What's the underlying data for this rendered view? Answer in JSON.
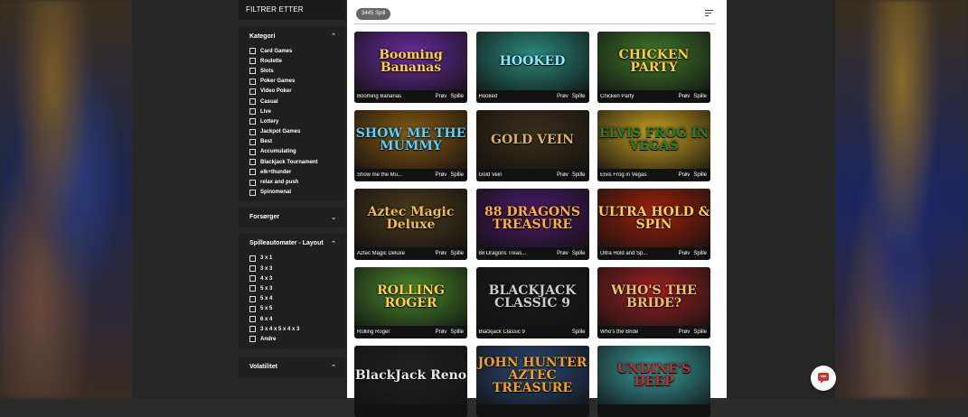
{
  "sidebar": {
    "header": "FILTRER ETTER",
    "kategori": {
      "title": "Kategori",
      "items": [
        "Card Games",
        "Roulette",
        "Slots",
        "Poker Games",
        "Video Poker",
        "Casual",
        "Live",
        "Lottery",
        "Jackpot Games",
        "Best",
        "Accumulating",
        "Blackjack Tournament",
        "elk+thunder",
        "relax and push",
        "Spinomenal"
      ]
    },
    "forsorger": {
      "title": "Forsørger"
    },
    "layout": {
      "title": "Spilleautomater - Layout",
      "items": [
        "3 x 1",
        "3 x 3",
        "4 x 3",
        "5 x 3",
        "5 x 4",
        "5 x 5",
        "6 x 4",
        "3 x 4 x 5 x 4 x 3",
        "Andre"
      ]
    },
    "volatilitet": {
      "title": "Volatilitet"
    }
  },
  "main": {
    "count": "3445 Spill",
    "games": [
      {
        "name": "Booming Bananas",
        "art": "Booming Bananas",
        "demo": "Prøv",
        "play": "Spille",
        "bg": "#6a2ca0",
        "color": "#ffd23a"
      },
      {
        "name": "Hooked",
        "art": "HOOKED",
        "demo": "Prøv",
        "play": "Spille",
        "bg": "#2a8a7a",
        "color": "#8fe8ff"
      },
      {
        "name": "Chicken Party",
        "art": "CHICKEN PARTY",
        "demo": "Prøv",
        "play": "Spille",
        "bg": "#3f7a2a",
        "color": "#ffcf3a"
      },
      {
        "name": "Show me the Mu...",
        "art": "SHOW ME THE MUMMY",
        "demo": "Prøv",
        "play": "Spille",
        "bg": "#8a5a10",
        "color": "#5ad0ff"
      },
      {
        "name": "Gold Vein",
        "art": "GOLD VEIN",
        "demo": "Prøv",
        "play": "Spille",
        "bg": "#3a2e1a",
        "color": "#d9b45a"
      },
      {
        "name": "Elvis Frog in Vegas",
        "art": "ELVIS FROG IN VEGAS",
        "demo": "Prøv",
        "play": "Spille",
        "bg": "#c8a020",
        "color": "#2e7d32"
      },
      {
        "name": "Aztec Magic Deluxe",
        "art": "Aztec Magic Deluxe",
        "demo": "Prøv",
        "play": "Spille",
        "bg": "#4a3a1a",
        "color": "#f0c040"
      },
      {
        "name": "88 Dragons Treas...",
        "art": "88 DRAGONS TREASURE",
        "demo": "Prøv",
        "play": "Spille",
        "bg": "#4a1a6a",
        "color": "#ffb030"
      },
      {
        "name": "Ultra Hold and Sp...",
        "art": "ULTRA HOLD & SPIN",
        "demo": "Prøv",
        "play": "Spille",
        "bg": "#a0200a",
        "color": "#ffd040"
      },
      {
        "name": "Rolling Roger",
        "art": "ROLLING ROGER",
        "demo": "Prøv",
        "play": "Spille",
        "bg": "#4a8a2a",
        "color": "#ffd23a"
      },
      {
        "name": "Blackjack Classic 9",
        "art": "BLACKJACK CLASSIC 9",
        "demo": "",
        "play": "Spille",
        "bg": "#1a1a1a",
        "color": "#cccccc"
      },
      {
        "name": "Who's the Bride",
        "art": "WHO'S THE BRIDE?",
        "demo": "Prøv",
        "play": "Spille",
        "bg": "#a02020",
        "color": "#f0c060"
      },
      {
        "name": "",
        "art": "BlackJack Reno",
        "demo": "",
        "play": "",
        "bg": "#222222",
        "color": "#e8e8e8"
      },
      {
        "name": "",
        "art": "JOHN HUNTER AZTEC TREASURE",
        "demo": "",
        "play": "",
        "bg": "#2a4a7a",
        "color": "#f0a020"
      },
      {
        "name": "",
        "art": "UNDINE'S DEEP",
        "demo": "",
        "play": "",
        "bg": "#3aa0a0",
        "color": "#c03030"
      }
    ]
  }
}
